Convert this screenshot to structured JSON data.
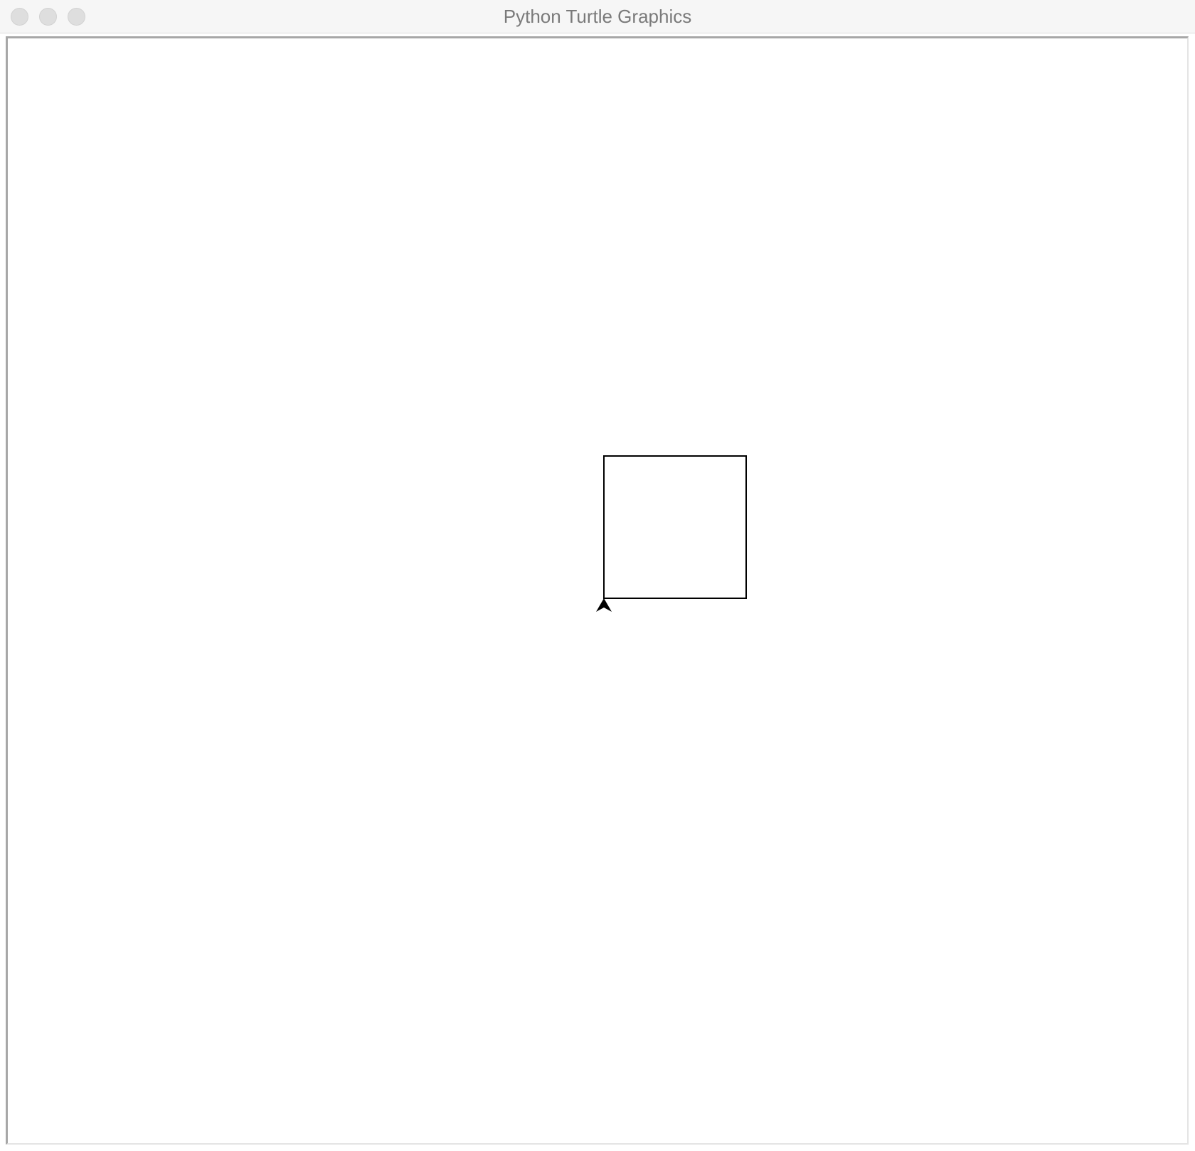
{
  "window": {
    "title": "Python Turtle Graphics",
    "controls": {
      "close": "close-button",
      "minimize": "minimize-button",
      "zoom": "zoom-button"
    }
  },
  "canvas": {
    "background": "#ffffff",
    "pen_color": "#000000",
    "turtle_shape": "classic-arrow",
    "turtle_heading": "up"
  }
}
